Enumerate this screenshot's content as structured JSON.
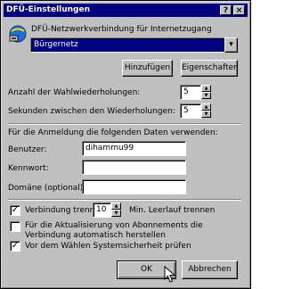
{
  "window": {
    "title": "DFÜ-Einstellungen",
    "help_button": "?",
    "close_button": "×"
  },
  "connection": {
    "label": "DFÜ-Netzwerkverbindung für Internetzugang",
    "selected": "Bürgernetz"
  },
  "buttons": {
    "add": "Hinzufügen",
    "properties": "Eigenschaften",
    "ok": "OK",
    "cancel": "Abbrechen"
  },
  "redial": {
    "attempts_label": "Anzahl der Wahlwiederholungen:",
    "attempts_value": "5",
    "seconds_label": "Sekunden zwischen den Wiederholungen:",
    "seconds_value": "5"
  },
  "login": {
    "intro": "Für die Anmeldung die folgenden Daten verwenden:",
    "user_label": "Benutzer:",
    "user_value": "dihammu99",
    "password_label": "Kennwort:",
    "password_value": "",
    "domain_label": "Domäne (optional):",
    "domain_value": ""
  },
  "options": {
    "disconnect_label": "Verbindung trennen",
    "disconnect_minutes": "10",
    "disconnect_suffix": "Min. Leerlauf trennen",
    "disconnect_checked": true,
    "subscriptions_label": "Für die Aktualisierung von Abonnements die Verbindung automatisch herstellen",
    "subscriptions_checked": false,
    "security_label": "Vor dem Wählen Systemsicherheit prüfen",
    "security_checked": true
  }
}
